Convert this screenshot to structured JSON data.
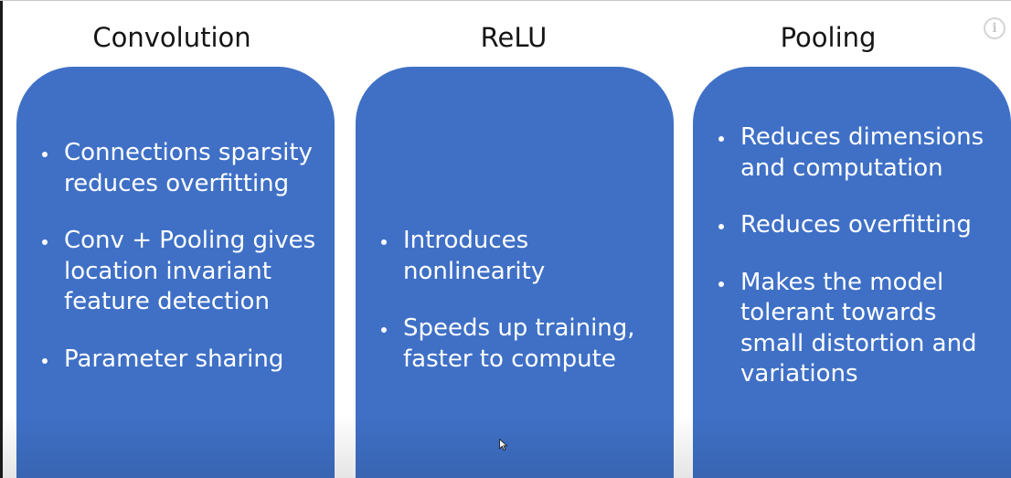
{
  "columns": [
    {
      "title": "Convolution",
      "bullets": [
        "Connections sparsity reduces overfitting",
        "Conv + Pooling gives location invariant feature detection",
        "Parameter sharing"
      ]
    },
    {
      "title": "ReLU",
      "bullets": [
        "Introduces nonlinearity",
        "Speeds up training, faster to compute"
      ]
    },
    {
      "title": "Pooling",
      "bullets": [
        "Reduces dimensions and computation",
        "Reduces overfitting",
        "Makes the model tolerant towards small distortion and variations"
      ]
    }
  ],
  "info_icon": {
    "glyph": "i",
    "icon": "info-icon"
  },
  "colors": {
    "card_blue": "#3f70c6",
    "title_text": "#151515",
    "bullet_text": "#ffffff"
  }
}
